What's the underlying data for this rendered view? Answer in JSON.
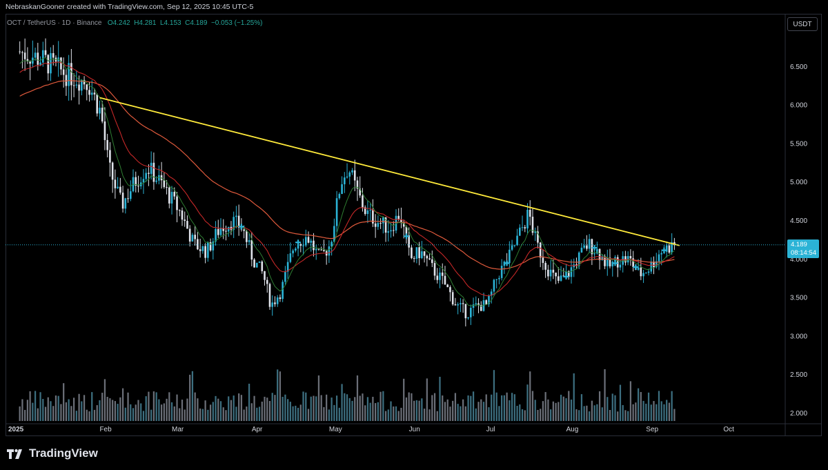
{
  "header": {
    "byline": "NebraskanGooner created with TradingView.com, Sep 12, 2025 10:45 UTC-5"
  },
  "legend": {
    "symbol": "OCT / TetherUS · 1D · Binance",
    "open": "O4.242",
    "high": "H4.281",
    "low": "L4.153",
    "close": "C4.189",
    "change": "−0.053 (−1.25%)"
  },
  "unit_button": "USDT",
  "last_price": {
    "value": "4.189",
    "countdown": "08:14:54"
  },
  "brand": {
    "name": "TradingView"
  },
  "colors": {
    "up": "#2bb3d6",
    "down": "#e0e3eb",
    "trendline": "#ffeb3b",
    "ema_long": "#e05a3c",
    "ema_mid": "#c62828",
    "ema_short": "#2e7d32",
    "volume": "#5d6b78",
    "crosses": "#2bb3d6"
  },
  "chart_data": {
    "type": "line",
    "price_axis_ticks": [
      "6.500",
      "6.000",
      "5.500",
      "5.000",
      "4.500",
      "4.000",
      "3.500",
      "3.000",
      "2.500",
      "2.000"
    ],
    "time_axis_labels": [
      "2025",
      "Feb",
      "Mar",
      "Apr",
      "May",
      "Jun",
      "Jul",
      "Aug",
      "Sep",
      "Oct"
    ],
    "ylim": [
      1.9,
      7.1
    ],
    "grid": false,
    "series": [
      {
        "name": "",
        "x": [
          "2025-01-01",
          "2025-01-10",
          "2025-01-20",
          "2025-01-28",
          "2025-02-02",
          "2025-02-05",
          "2025-02-10",
          "2025-02-15",
          "2025-02-20",
          "2025-02-25",
          "2025-03-01",
          "2025-03-05",
          "2025-03-10",
          "2025-03-15",
          "2025-03-20",
          "2025-03-25",
          "2025-03-29",
          "2025-04-02",
          "2025-04-06",
          "2025-04-09",
          "2025-04-13",
          "2025-04-18",
          "2025-04-23",
          "2025-04-28",
          "2025-05-02",
          "2025-05-06",
          "2025-05-09",
          "2025-05-12",
          "2025-05-16",
          "2025-05-20",
          "2025-05-25",
          "2025-05-29",
          "2025-06-02",
          "2025-06-06",
          "2025-06-10",
          "2025-06-15",
          "2025-06-20",
          "2025-06-24",
          "2025-06-28",
          "2025-07-02",
          "2025-07-06",
          "2025-07-10",
          "2025-07-14",
          "2025-07-18",
          "2025-07-21",
          "2025-07-25",
          "2025-07-29",
          "2025-08-02",
          "2025-08-06",
          "2025-08-10",
          "2025-08-14",
          "2025-08-18",
          "2025-08-22",
          "2025-08-26",
          "2025-08-30",
          "2025-09-03",
          "2025-09-07",
          "2025-09-12"
        ],
        "values": [
          6.7,
          6.6,
          6.4,
          6.3,
          5.9,
          5.2,
          4.7,
          5.0,
          5.2,
          5.0,
          4.8,
          4.6,
          4.2,
          4.1,
          4.4,
          4.5,
          4.4,
          4.0,
          3.8,
          3.4,
          3.6,
          4.2,
          4.3,
          4.0,
          4.2,
          5.0,
          5.2,
          4.9,
          4.6,
          4.5,
          4.4,
          4.6,
          4.0,
          4.1,
          3.9,
          3.7,
          3.4,
          3.3,
          3.4,
          3.4,
          3.8,
          4.0,
          4.3,
          4.6,
          4.2,
          3.9,
          3.7,
          3.8,
          4.0,
          4.2,
          4.1,
          3.9,
          4.0,
          4.0,
          3.8,
          3.9,
          4.1,
          4.19
        ]
      },
      {
        "name": "",
        "x": [
          "2025-02-01",
          "2025-09-14"
        ],
        "values": [
          6.1,
          4.18
        ]
      }
    ]
  }
}
